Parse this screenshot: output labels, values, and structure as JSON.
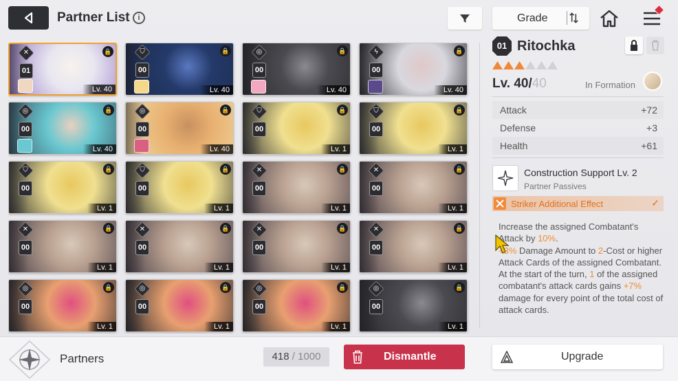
{
  "header": {
    "title": "Partner List",
    "info_icon": "i",
    "grade_label": "Grade"
  },
  "cards": [
    {
      "count": "01",
      "level": "Lv. 40",
      "class_icon": "sword-icon",
      "selected": true,
      "colors": [
        "#e8e6f0",
        "#9b7fc8",
        "#f7f2ee"
      ],
      "portrait": "#f0d8c0"
    },
    {
      "count": "00",
      "level": "Lv. 40",
      "class_icon": "shield-icon",
      "selected": false,
      "colors": [
        "#243a6a",
        "#1d2a4d",
        "#5a78c0"
      ],
      "portrait": "#f5d88a"
    },
    {
      "count": "00",
      "level": "Lv. 40",
      "class_icon": "target-icon",
      "selected": false,
      "colors": [
        "#4a4a50",
        "#2a2a2e",
        "#8a8a90"
      ],
      "portrait": "#f2a8c0"
    },
    {
      "count": "00",
      "level": "Lv. 40",
      "class_icon": "bolt-icon",
      "selected": false,
      "colors": [
        "#d8d8de",
        "#2a2a30",
        "#e0c8c8"
      ],
      "portrait": "#5a4a8a"
    },
    {
      "count": "00",
      "level": "Lv. 40",
      "class_icon": "target-icon",
      "selected": false,
      "colors": [
        "#6ac8d0",
        "#3a5a68",
        "#e8d0c0"
      ],
      "portrait": "#6ac8d0"
    },
    {
      "count": "00",
      "level": "Lv. 40",
      "class_icon": "target-icon",
      "selected": false,
      "colors": [
        "#e8b070",
        "#f0d8a0",
        "#c89060"
      ],
      "portrait": "#d86080"
    },
    {
      "count": "00",
      "level": "Lv. 1",
      "class_icon": "shield-icon",
      "selected": false,
      "colors": [
        "#f0e090",
        "#3a3a3a",
        "#e8c860"
      ],
      "portrait": ""
    },
    {
      "count": "00",
      "level": "Lv. 1",
      "class_icon": "shield-icon",
      "selected": false,
      "colors": [
        "#f0e090",
        "#3a3a3a",
        "#e8c860"
      ],
      "portrait": ""
    },
    {
      "count": "00",
      "level": "Lv. 1",
      "class_icon": "shield-icon",
      "selected": false,
      "colors": [
        "#f0e090",
        "#3a3a3a",
        "#e8c860"
      ],
      "portrait": ""
    },
    {
      "count": "00",
      "level": "Lv. 1",
      "class_icon": "shield-icon",
      "selected": false,
      "colors": [
        "#f0e090",
        "#3a3a3a",
        "#e8c860"
      ],
      "portrait": ""
    },
    {
      "count": "00",
      "level": "Lv. 1",
      "class_icon": "sword-icon",
      "selected": false,
      "colors": [
        "#b8a090",
        "#4a4048",
        "#d8c8b8"
      ],
      "portrait": ""
    },
    {
      "count": "00",
      "level": "Lv. 1",
      "class_icon": "sword-icon",
      "selected": false,
      "colors": [
        "#b8a090",
        "#4a4048",
        "#d8c8b8"
      ],
      "portrait": ""
    },
    {
      "count": "00",
      "level": "Lv. 1",
      "class_icon": "sword-icon",
      "selected": false,
      "colors": [
        "#b8a090",
        "#4a4048",
        "#d8c8b8"
      ],
      "portrait": ""
    },
    {
      "count": "00",
      "level": "Lv. 1",
      "class_icon": "sword-icon",
      "selected": false,
      "colors": [
        "#b8a090",
        "#4a4048",
        "#d8c8b8"
      ],
      "portrait": ""
    },
    {
      "count": "00",
      "level": "Lv. 1",
      "class_icon": "sword-icon",
      "selected": false,
      "colors": [
        "#b8a090",
        "#4a4048",
        "#d8c8b8"
      ],
      "portrait": ""
    },
    {
      "count": "00",
      "level": "Lv. 1",
      "class_icon": "sword-icon",
      "selected": false,
      "colors": [
        "#b8a090",
        "#4a4048",
        "#d8c8b8"
      ],
      "portrait": ""
    },
    {
      "count": "00",
      "level": "Lv. 1",
      "class_icon": "target-icon",
      "selected": false,
      "colors": [
        "#e8a070",
        "#2a2a2e",
        "#e05080"
      ],
      "portrait": ""
    },
    {
      "count": "00",
      "level": "Lv. 1",
      "class_icon": "target-icon",
      "selected": false,
      "colors": [
        "#e8a070",
        "#2a2a2e",
        "#e05080"
      ],
      "portrait": ""
    },
    {
      "count": "00",
      "level": "Lv. 1",
      "class_icon": "target-icon",
      "selected": false,
      "colors": [
        "#e8a070",
        "#2a2a2e",
        "#e05080"
      ],
      "portrait": ""
    },
    {
      "count": "00",
      "level": "Lv. 1",
      "class_icon": "target-icon",
      "selected": false,
      "colors": [
        "#4a4a50",
        "#2a2a2e",
        "#8a8a90"
      ],
      "portrait": ""
    }
  ],
  "detail": {
    "number": "01",
    "name": "Ritochka",
    "stars_filled": 3,
    "stars_total": 6,
    "star_color": "#f0883a",
    "level_prefix": "Lv. 40/",
    "level_max": "40",
    "formation_label": "In Formation",
    "stats": [
      {
        "name": "Attack",
        "value": "+72"
      },
      {
        "name": "Defense",
        "value": "+3"
      },
      {
        "name": "Health",
        "value": "+61"
      }
    ],
    "skill_name": "Construction Support Lv. 2",
    "skill_sub": "Partner Passives",
    "effect_label": "Striker Additional Effect",
    "desc": {
      "t1": "Increase the assigned Combatant's Attack by ",
      "h1": "10%",
      "t2": ".",
      "h2": "+3%",
      "t3": " Damage Amount to ",
      "h3": "2",
      "t4": "-Cost or higher Attack Cards of the assigned Combatant.",
      "t5": "At the start of the turn, ",
      "h4": "1",
      "t6": " of the assigned combatant's attack cards gains ",
      "h5": "+7%",
      "t7": " damage for every point of the total cost of attack cards."
    }
  },
  "footer": {
    "partners_label": "Partners",
    "count_current": "418",
    "count_sep": " / ",
    "count_total": "1000",
    "dismantle_label": "Dismantle",
    "upgrade_label": "Upgrade"
  },
  "colors": {
    "accent": "#c8324a",
    "highlight": "#ee8a2f",
    "selected_border": "#f0a02a"
  }
}
